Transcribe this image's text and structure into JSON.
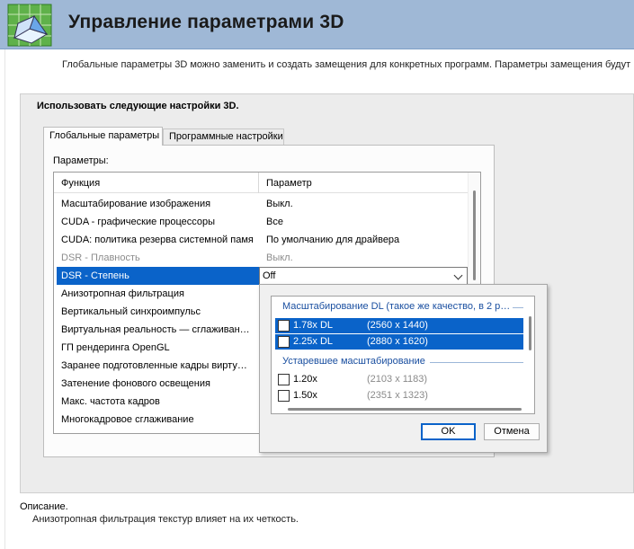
{
  "header": {
    "title": "Управление параметрами 3D",
    "subtitle": "Глобальные параметры 3D можно заменить и создать замещения для конкретных программ. Параметры замещения будут"
  },
  "panel": {
    "title": "Использовать следующие настройки 3D.",
    "tabs": [
      {
        "label": "Глобальные параметры",
        "active": true
      },
      {
        "label": "Программные настройки",
        "active": false
      }
    ],
    "params_label": "Параметры:",
    "columns": {
      "function": "Функция",
      "parameter": "Параметр"
    },
    "rows": [
      {
        "function": "Масштабирование изображения",
        "parameter": "Выкл."
      },
      {
        "function": "CUDA - графические процессоры",
        "parameter": "Все"
      },
      {
        "function": "CUDA: политика резерва системной памя…",
        "parameter": "По умолчанию для драйвера"
      },
      {
        "function": "DSR - Плавность",
        "parameter": "Выкл."
      },
      {
        "function": "DSR - Степень",
        "parameter": "Off"
      },
      {
        "function": "Анизотропная фильтрация",
        "parameter": ""
      },
      {
        "function": "Вертикальный синхроимпульс",
        "parameter": ""
      },
      {
        "function": "Виртуальная реальность — сглаживан…",
        "parameter": ""
      },
      {
        "function": "ГП рендеринга OpenGL",
        "parameter": ""
      },
      {
        "function": "Заранее подготовленные кадры вирту…",
        "parameter": ""
      },
      {
        "function": "Затенение фонового освещения",
        "parameter": ""
      },
      {
        "function": "Макс. частота кадров",
        "parameter": ""
      },
      {
        "function": "Многокадровое сглаживание",
        "parameter": ""
      }
    ]
  },
  "dropdown": {
    "group1": "Масштабирование DL (такое же качество, в 2 р…",
    "group2": "Устаревшее масштабирование",
    "options": [
      {
        "label": "1.78x DL",
        "res": "(2560 x 1440)"
      },
      {
        "label": "2.25x DL",
        "res": "(2880 x 1620)"
      },
      {
        "label": "1.20x",
        "res": "(2103 x 1183)"
      },
      {
        "label": "1.50x",
        "res": "(2351 x 1323)"
      }
    ],
    "ok": "OK",
    "cancel": "Отмена"
  },
  "description": {
    "label": "Описание.",
    "text": "Анизотропная фильтрация текстур влияет на их четкость."
  },
  "colors": {
    "header": "#9fb8d6",
    "selection": "#0a63c9",
    "group_text": "#1a4fa0"
  }
}
